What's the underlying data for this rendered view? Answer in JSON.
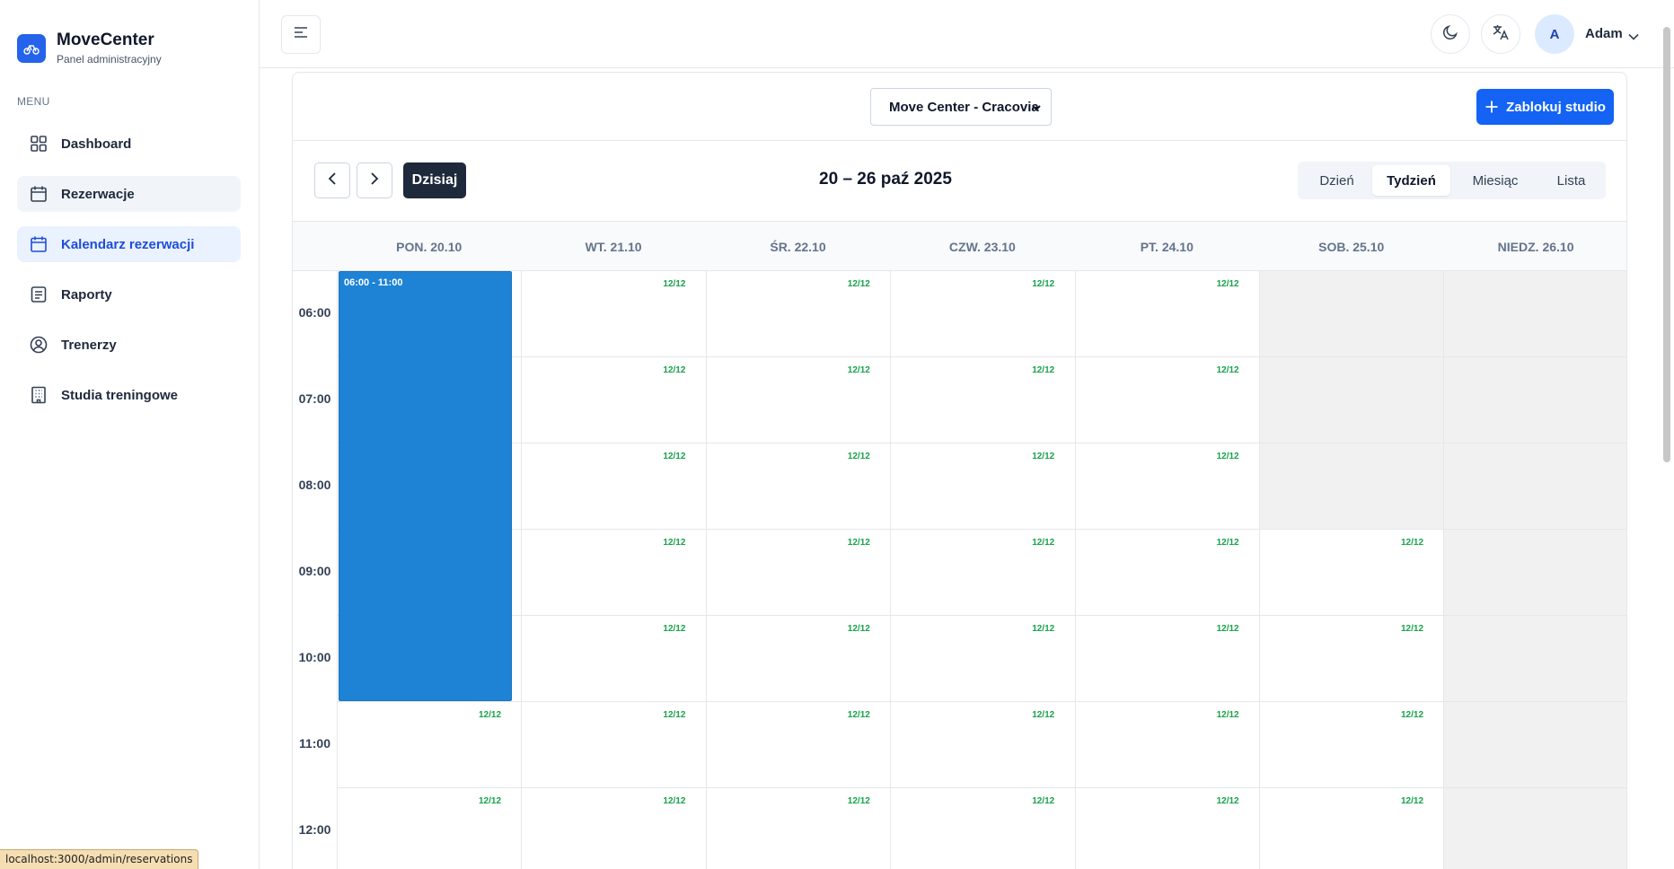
{
  "brand": {
    "title": "MoveCenter",
    "subtitle": "Panel administracyjny"
  },
  "sidebar": {
    "menu_label": "MENU",
    "items": [
      {
        "label": "Dashboard",
        "icon": "dashboard-icon"
      },
      {
        "label": "Rezerwacje",
        "icon": "calendar-icon"
      },
      {
        "label": "Kalendarz rezerwacji",
        "icon": "calendar-icon"
      },
      {
        "label": "Raporty",
        "icon": "report-icon"
      },
      {
        "label": "Trenerzy",
        "icon": "user-circle-icon"
      },
      {
        "label": "Studia treningowe",
        "icon": "building-icon"
      }
    ]
  },
  "header": {
    "avatar_initial": "A",
    "user_name": "Adam"
  },
  "toolbar": {
    "studio_select_value": "Move Center - Cracovia",
    "block_button_label": "Zablokuj studio",
    "today_label": "Dzisiaj",
    "range_title": "20 – 26 paź 2025",
    "views": [
      "Dzień",
      "Tydzień",
      "Miesiąc",
      "Lista"
    ],
    "active_view": "Tydzień"
  },
  "calendar": {
    "days": [
      "PON. 20.10",
      "WT. 21.10",
      "ŚR. 22.10",
      "CZW. 23.10",
      "PT. 24.10",
      "SOB. 25.10",
      "NIEDZ. 26.10"
    ],
    "times": [
      "06:00",
      "07:00",
      "08:00",
      "09:00",
      "10:00",
      "11:00",
      "12:00"
    ],
    "slot_capacity": "12/12",
    "event": {
      "label": "06:00 - 11:00",
      "day": "PON. 20.10",
      "start": "06:00",
      "end": "11:00"
    }
  },
  "status_bar_url": "localhost:3000/admin/reservations",
  "colors": {
    "accent": "#1463f5",
    "event": "#1e83d4",
    "badge": "#16a34a",
    "active_nav_bg": "#eaf1ff"
  }
}
